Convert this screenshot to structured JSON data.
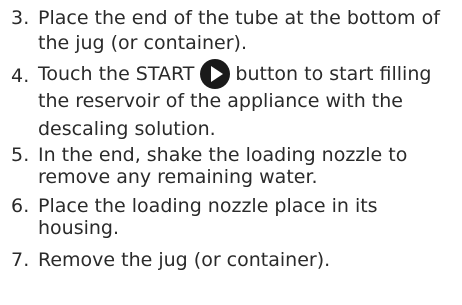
{
  "steps": [
    {
      "number": "3.",
      "lines": [
        "Place the end of the tube at the bottom of",
        "the jug (or container)."
      ]
    },
    {
      "number": "4.",
      "before_icon": "Touch the START",
      "icon": "play-button-icon",
      "after_icon": "button to start filling",
      "lines": [
        "the reservoir of the appliance with the",
        "descaling solution."
      ]
    },
    {
      "number": "5.",
      "lines": [
        "In the end, shake the loading nozzle to",
        "remove any remaining water."
      ]
    },
    {
      "number": "6.",
      "lines": [
        "Place the loading nozzle place in its",
        "housing."
      ]
    },
    {
      "number": "7.",
      "lines": [
        "Remove the jug (or container)."
      ]
    }
  ],
  "colors": {
    "text": "#2a2a2a",
    "icon_circle": "#1a1a1a",
    "icon_triangle": "#ffffff"
  }
}
